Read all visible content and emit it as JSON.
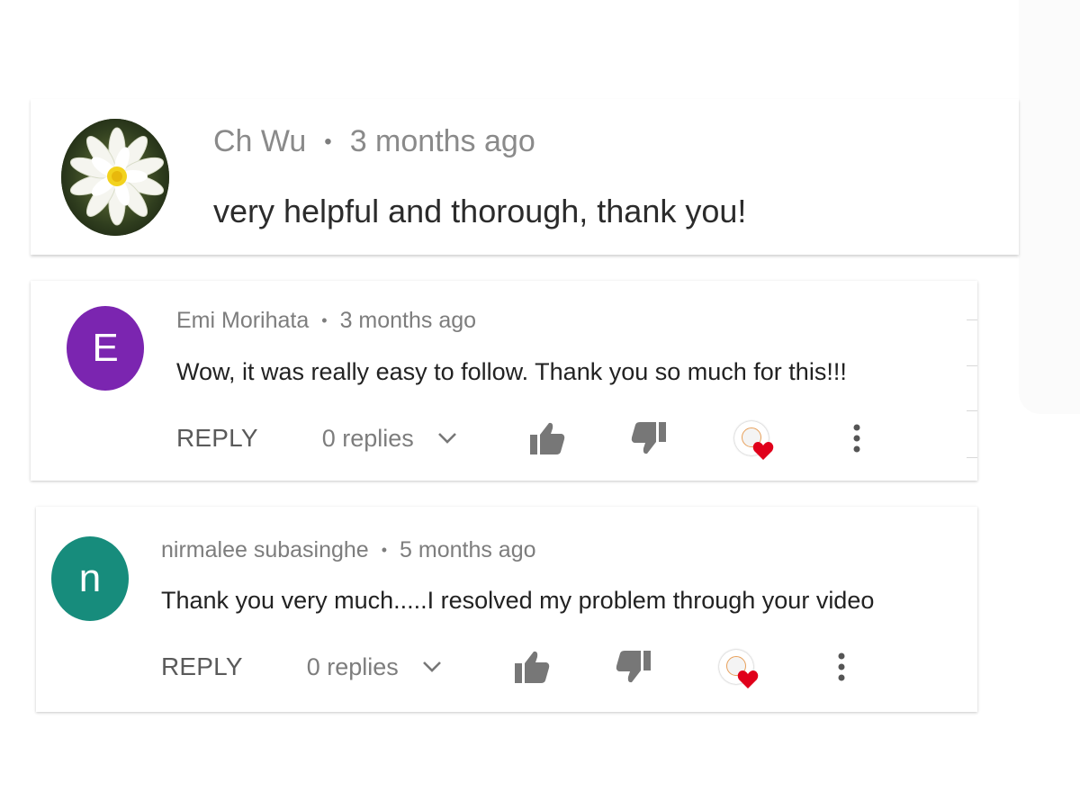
{
  "comments": [
    {
      "author": "Ch Wu",
      "separator": "•",
      "time": "3 months ago",
      "text": "very helpful and thorough, thank you!",
      "avatar_type": "flower-photo"
    },
    {
      "author": "Emi Morihata",
      "separator": "•",
      "time": "3 months ago",
      "text": "Wow, it was really easy to follow. Thank you so much for this!!!",
      "avatar_letter": "E",
      "avatar_color": "#7b25b0",
      "reply_label": "REPLY",
      "replies_label": "0 replies"
    },
    {
      "author": "nirmalee subasinghe",
      "separator": "•",
      "time": "5 months ago",
      "text": "Thank you very much.....I resolved my problem through your video",
      "avatar_letter": "n",
      "avatar_color": "#178c7c",
      "reply_label": "REPLY",
      "replies_label": "0 replies"
    }
  ],
  "icons": {
    "like": "thumbs-up-icon",
    "dislike": "thumbs-down-icon",
    "creator_heart": "creator-heart-icon",
    "more": "more-vertical-icon",
    "expand": "chevron-down-icon"
  },
  "colors": {
    "icon_gray": "#777777",
    "heart_red": "#e0001b"
  }
}
